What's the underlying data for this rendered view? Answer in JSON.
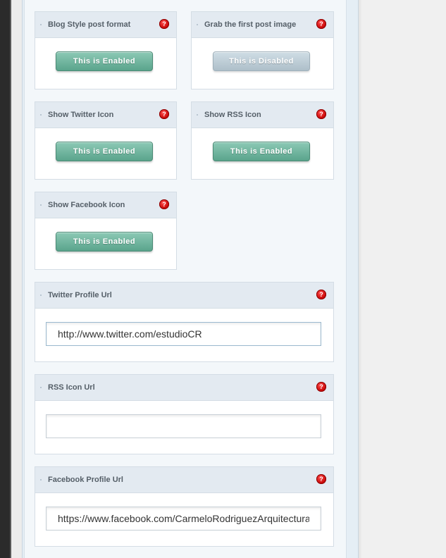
{
  "settings": {
    "blog_style": {
      "title": "Blog Style post format",
      "toggle": "This is Enabled",
      "state": "enabled"
    },
    "first_image": {
      "title": "Grab the first post image",
      "toggle": "This is Disabled",
      "state": "disabled"
    },
    "twitter_icon": {
      "title": "Show Twitter Icon",
      "toggle": "This is Enabled",
      "state": "enabled"
    },
    "rss_icon": {
      "title": "Show RSS Icon",
      "toggle": "This is Enabled",
      "state": "enabled"
    },
    "facebook_icon": {
      "title": "Show Facebook Icon",
      "toggle": "This is Enabled",
      "state": "enabled"
    }
  },
  "fields": {
    "twitter_url": {
      "title": "Twitter Profile Url",
      "value": "http://www.twitter.com/estudioCR"
    },
    "rss_url": {
      "title": "RSS Icon Url",
      "value": ""
    },
    "facebook_url": {
      "title": "Facebook Profile Url",
      "value": "https://www.facebook.com/CarmeloRodriguezArquitectura"
    }
  },
  "help_glyph": "?",
  "colors": {
    "enabled": "#5aa48c",
    "disabled": "#aebfc9",
    "help": "#cc0000",
    "header_bg": "#e3eaf1"
  }
}
